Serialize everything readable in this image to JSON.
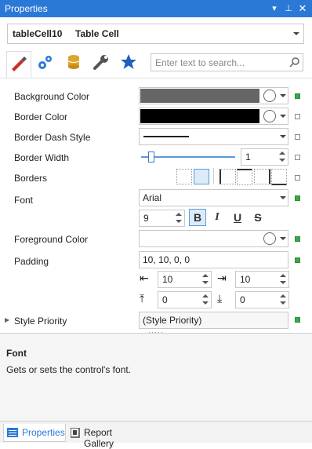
{
  "window": {
    "title": "Properties"
  },
  "selector": {
    "name": "tableCell10",
    "type": "Table Cell"
  },
  "search": {
    "placeholder": "Enter text to search..."
  },
  "icons": [
    "brush-icon",
    "gears-icon",
    "database-icon",
    "wrench-icon",
    "star-icon"
  ],
  "properties": {
    "background_color": {
      "label": "Background Color",
      "color": "#666666"
    },
    "border_color": {
      "label": "Border Color",
      "color": "#000000"
    },
    "border_dash_style": {
      "label": "Border Dash Style"
    },
    "border_width": {
      "label": "Border Width",
      "value": "1"
    },
    "borders": {
      "label": "Borders"
    },
    "font": {
      "label": "Font",
      "family": "Arial",
      "size": "9"
    },
    "foreground_color": {
      "label": "Foreground Color"
    },
    "padding": {
      "label": "Padding",
      "value": "10, 10, 0, 0",
      "left": "10",
      "right": "10",
      "top": "0",
      "bottom": "0"
    },
    "style_priority": {
      "label": "Style Priority",
      "value": "(Style Priority)"
    }
  },
  "format_buttons": {
    "bold": "B",
    "italic": "I",
    "underline": "U",
    "strike": "S"
  },
  "description": {
    "heading": "Font",
    "text": "Gets or sets the control's font."
  },
  "bottom_tabs": {
    "properties": "Properties",
    "gallery": "Report Gallery"
  },
  "colors": {
    "accent": "#2b79d7",
    "green": "#3aa846"
  }
}
